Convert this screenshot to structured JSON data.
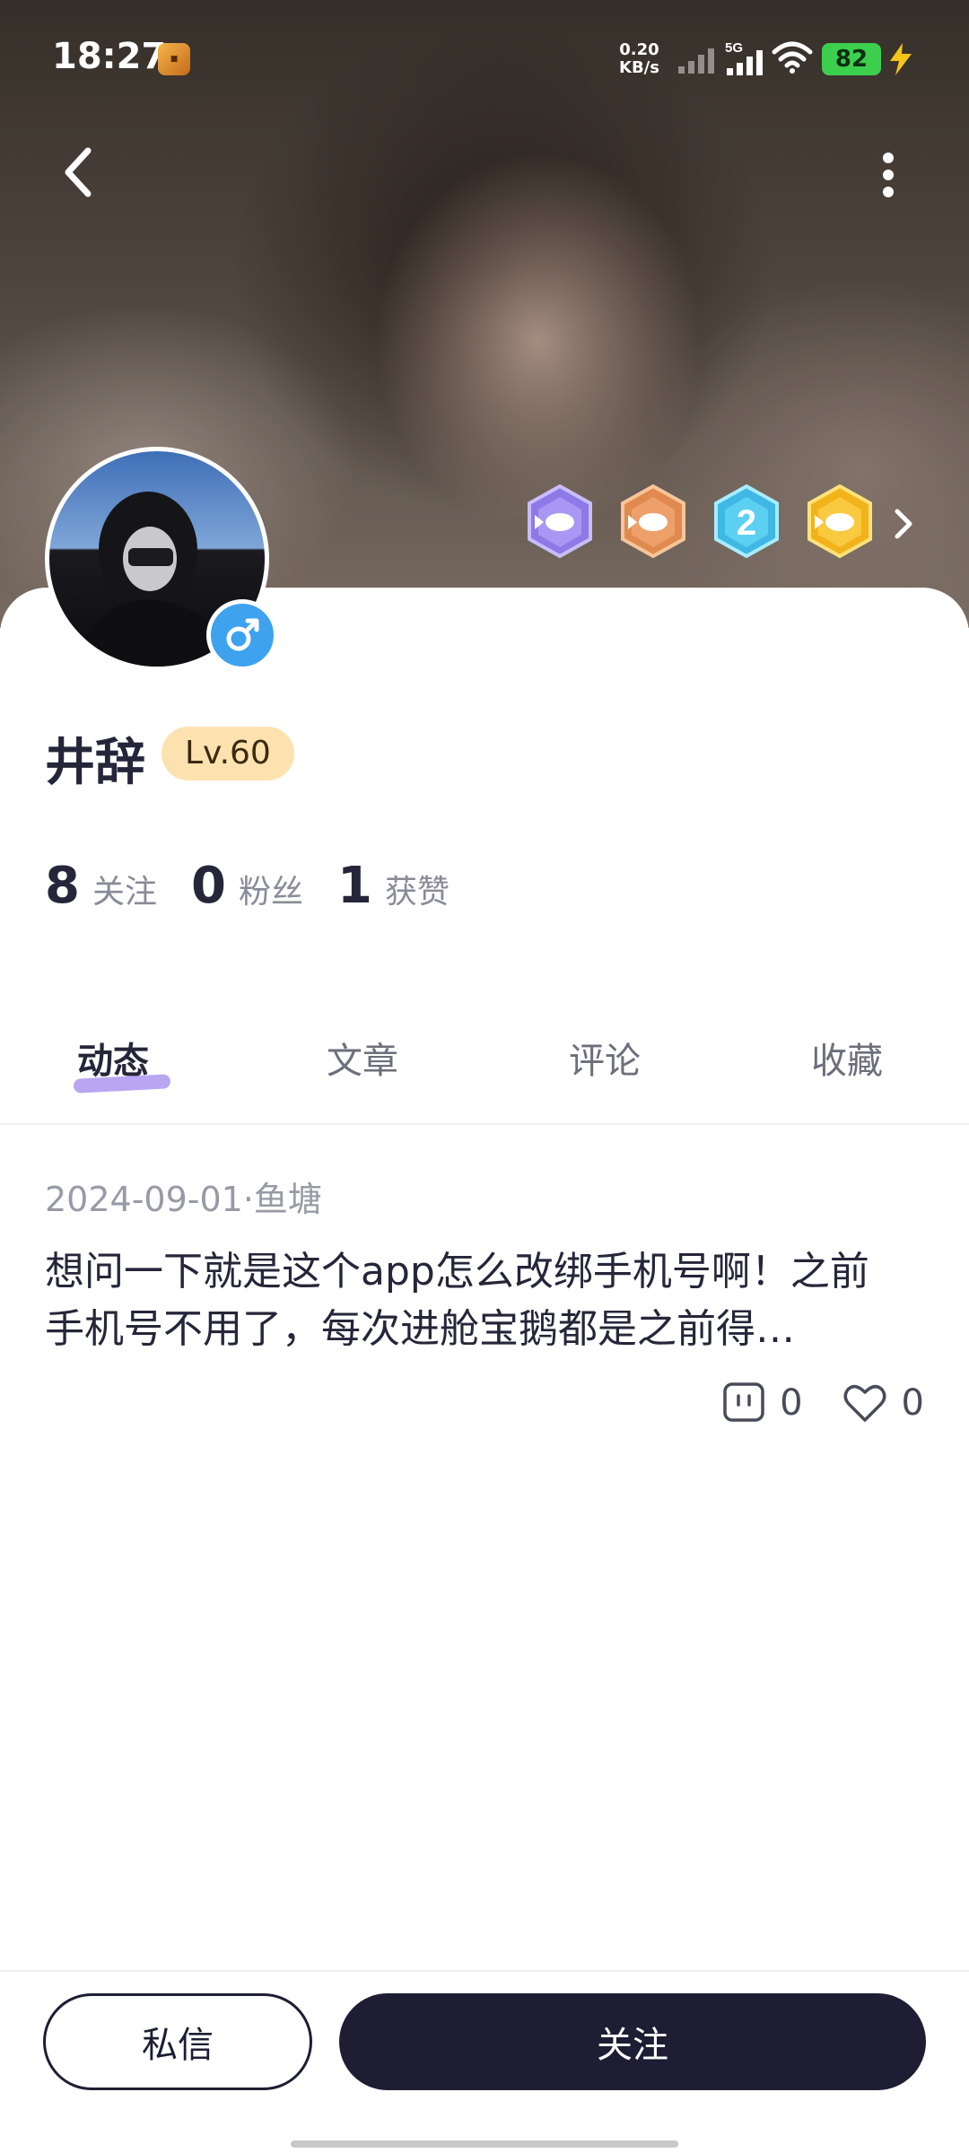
{
  "status_bar": {
    "time": "18:27",
    "net_speed_value": "0.20",
    "net_speed_unit": "KB/s",
    "network_type": "5G",
    "battery": "82"
  },
  "header": {
    "back_icon": "chevron-left-icon",
    "more_icon": "more-vertical-icon",
    "badges": [
      "purple-fish-badge",
      "orange-fish-badge",
      "blue-number-2-badge",
      "gold-fish-badge"
    ]
  },
  "profile": {
    "username": "井辞",
    "level": "Lv.60",
    "gender_icon": "male-icon",
    "stats": [
      {
        "value": "8",
        "label": "关注"
      },
      {
        "value": "0",
        "label": "粉丝"
      },
      {
        "value": "1",
        "label": "获赞"
      }
    ]
  },
  "tabs": [
    {
      "label": "动态",
      "active": true
    },
    {
      "label": "文章",
      "active": false
    },
    {
      "label": "评论",
      "active": false
    },
    {
      "label": "收藏",
      "active": false
    }
  ],
  "post": {
    "meta": "2024-09-01·鱼塘",
    "text": "想问一下就是这个app怎么改绑手机号啊！之前手机号不用了，每次进舱宝鹅都是之前得…",
    "comments": "0",
    "likes": "0"
  },
  "bottom": {
    "message_label": "私信",
    "follow_label": "关注"
  },
  "colors": {
    "primary_dark": "#1e1d33",
    "level_pill": "#fde2b0",
    "tab_highlight": "#b9a6f2",
    "gender_blue": "#3ea2ee"
  }
}
